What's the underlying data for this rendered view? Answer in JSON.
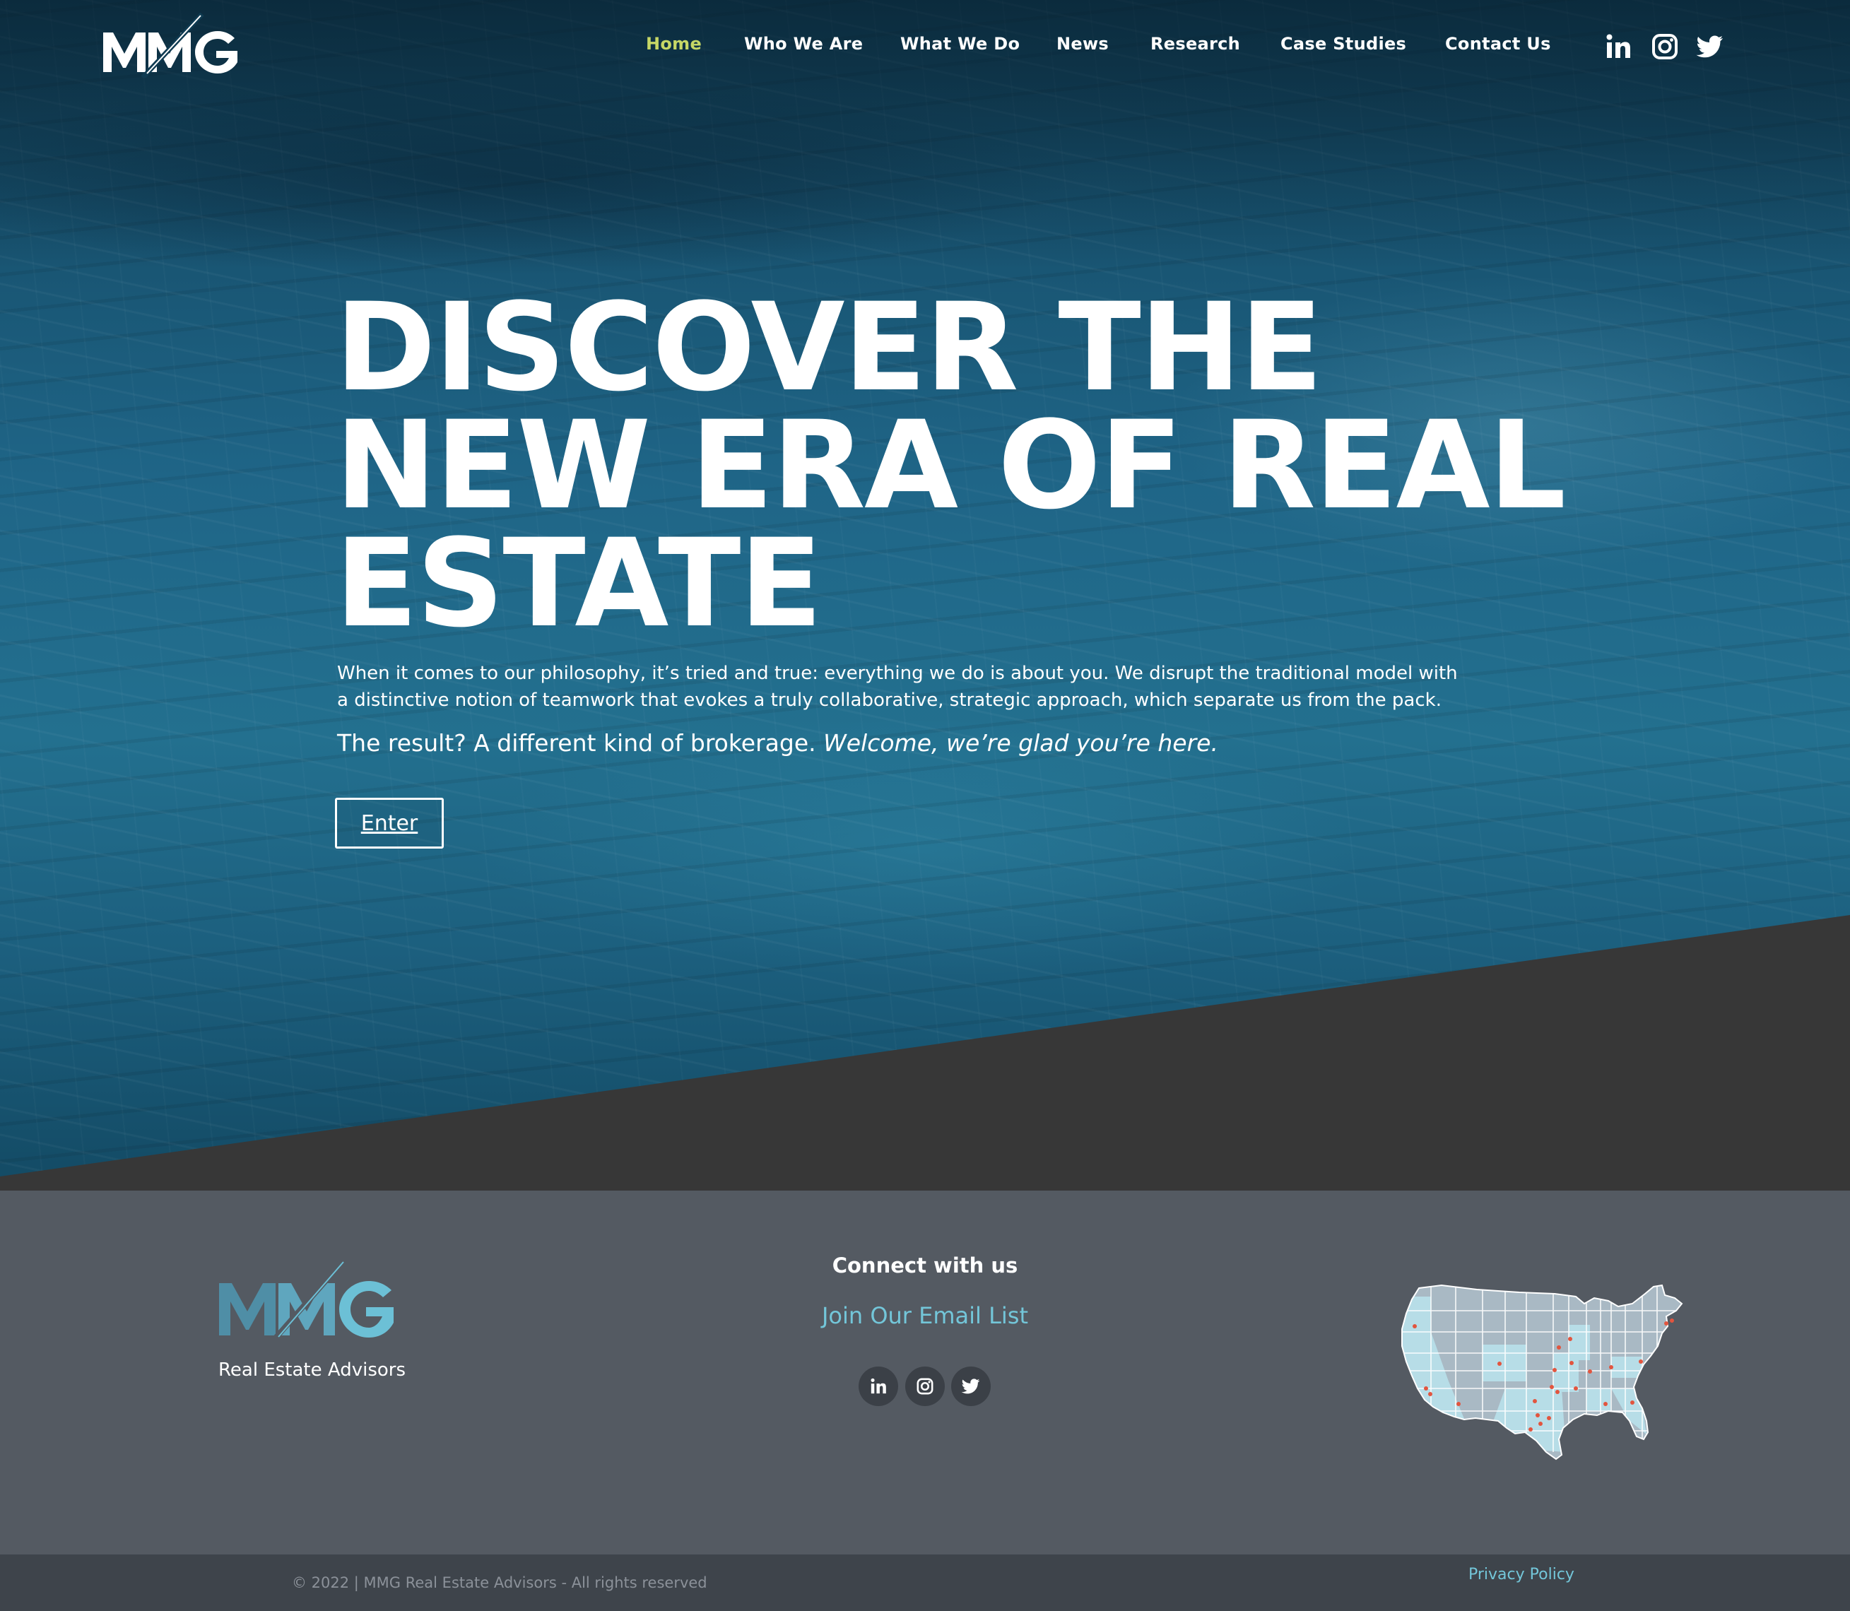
{
  "brand": {
    "logo_text": "MMG",
    "footer_subtitle": "Real Estate Advisors"
  },
  "nav": {
    "items": [
      {
        "label": "Home",
        "active": true
      },
      {
        "label": "Who We Are"
      },
      {
        "label": "What We Do"
      },
      {
        "label": "News"
      },
      {
        "label": "Research"
      },
      {
        "label": "Case Studies"
      },
      {
        "label": "Contact Us"
      }
    ],
    "social_icons": [
      "linkedin-icon",
      "instagram-icon",
      "twitter-icon"
    ]
  },
  "hero": {
    "headline_lines": [
      "DISCOVER THE",
      "NEW ERA OF REAL",
      "ESTATE"
    ],
    "intro": "When it comes to our philosophy, it’s tried and true: everything we do is about you. We disrupt the traditional model with a distinctive notion of teamwork that evokes a truly collaborative, strategic approach, which separate us from the pack.",
    "tagline_plain": "The result? A different kind of brokerage.",
    "tagline_italic": "Welcome, we’re glad you’re here.",
    "cta_label": "Enter"
  },
  "footer": {
    "connect_title": "Connect with us",
    "email_link": "Join Our Email List",
    "social_icons": [
      "linkedin-icon",
      "instagram-icon",
      "twitter-icon"
    ],
    "map_icon": "us-map-icon",
    "copyright": "© 2022 | MMG Real Estate Advisors - All rights reserved",
    "privacy_link": "Privacy Policy"
  },
  "colors": {
    "nav_active": "#c6d766",
    "accent_link": "#73c6d9",
    "hero_overlay": "#1f6587",
    "diagonal_band": "#373737",
    "footer_bg": "#545a62",
    "bottom_bar_bg": "#3e444b",
    "map_dot": "#e2553f"
  }
}
